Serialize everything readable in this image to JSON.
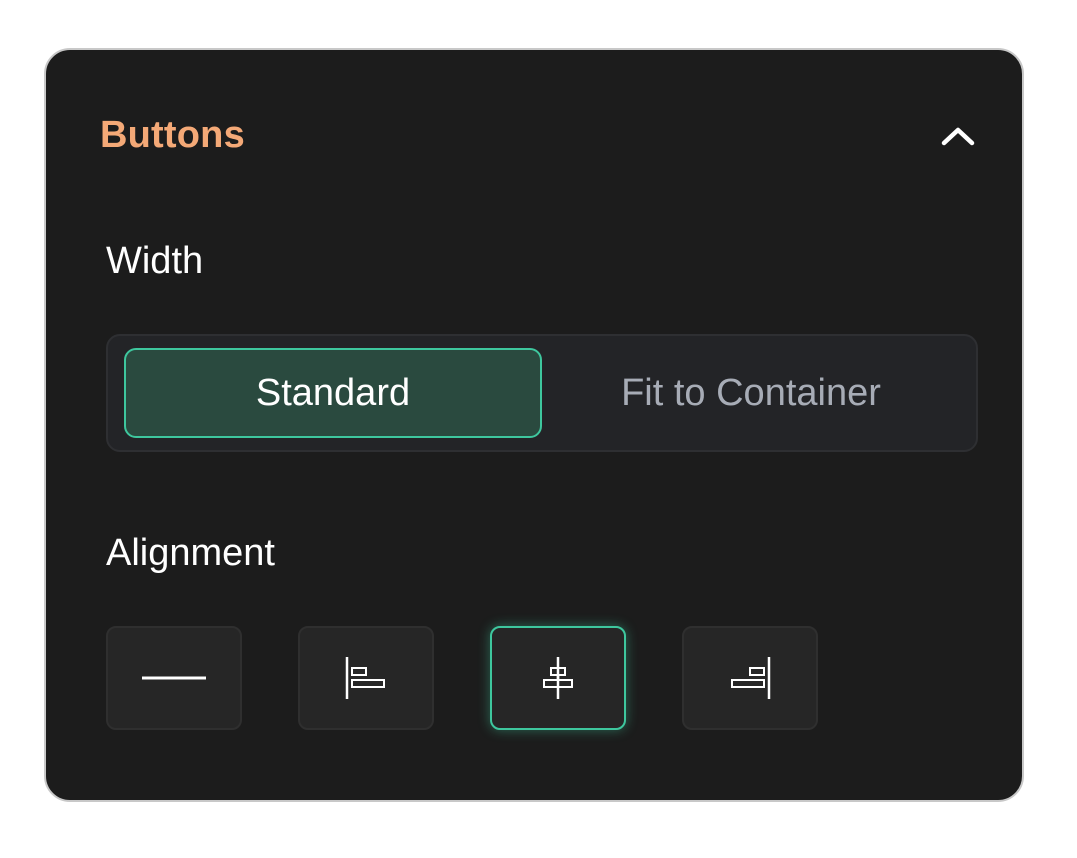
{
  "panel": {
    "title": "Buttons",
    "collapse_icon": "chevron-up-icon"
  },
  "width": {
    "label": "Width",
    "options": [
      {
        "label": "Standard",
        "selected": true
      },
      {
        "label": "Fit to Container",
        "selected": false
      }
    ]
  },
  "alignment": {
    "label": "Alignment",
    "options": [
      {
        "icon": "stretch-icon",
        "selected": false
      },
      {
        "icon": "align-left-icon",
        "selected": false
      },
      {
        "icon": "align-center-icon",
        "selected": true
      },
      {
        "icon": "align-right-icon",
        "selected": false
      }
    ]
  },
  "colors": {
    "title": "#f4a977",
    "accent": "#3ec79e",
    "panel_bg": "#1c1c1c",
    "active_segment_bg": "#2a4a3f"
  }
}
